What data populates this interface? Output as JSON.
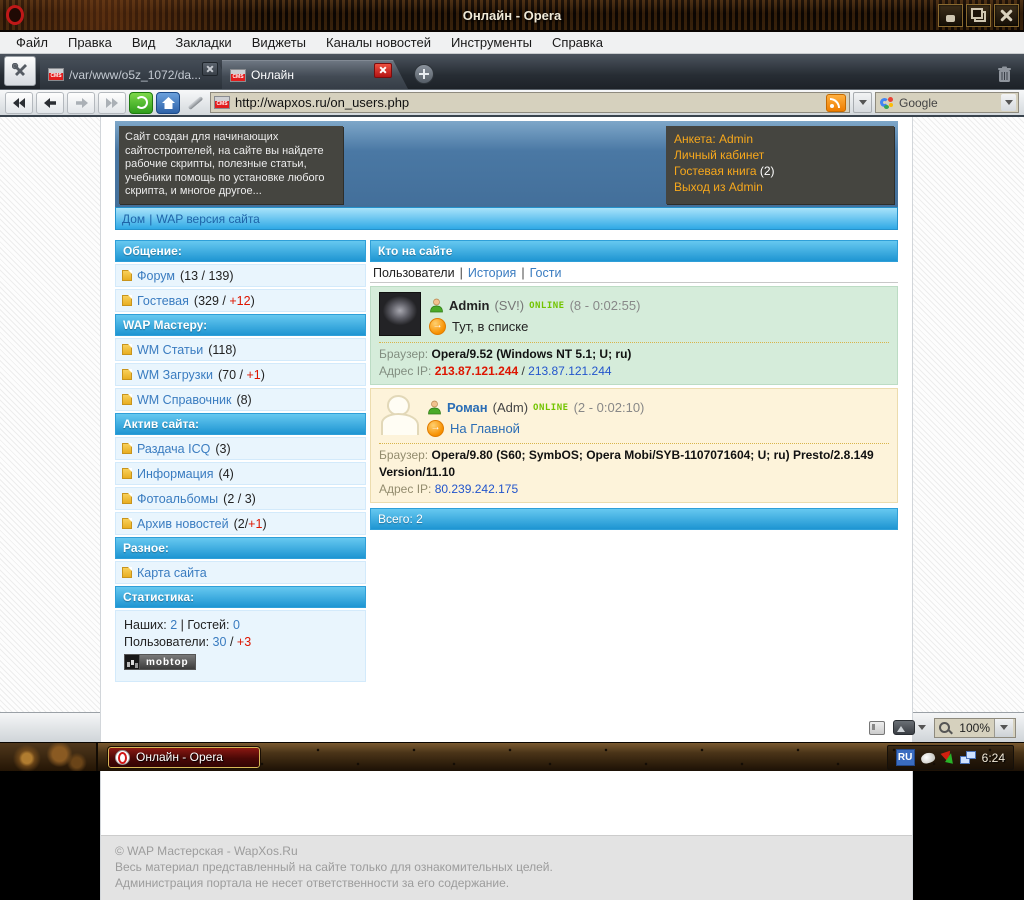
{
  "window": {
    "title": "Онлайн - Opera"
  },
  "menu": {
    "items": [
      "Файл",
      "Правка",
      "Вид",
      "Закладки",
      "Виджеты",
      "Каналы новостей",
      "Инструменты",
      "Справка"
    ]
  },
  "icons": {
    "cms": "CMS"
  },
  "tabs": {
    "tab1": "/var/www/o5z_1072/da...",
    "tab2": "Онлайн"
  },
  "address": {
    "url": "http://wapxos.ru/on_users.php",
    "search": "Google"
  },
  "site": {
    "description": "Сайт создан для начинающих сайтостроителей, на сайте вы найдете рабочие скрипты, полезные статьи, учебники помощь по установке любого скрипта, и многое другое...",
    "account": {
      "l1": "Анкета: Admin",
      "l2": "Личный кабинет",
      "l3": "Гостевая книга",
      "l3_count": "(2)",
      "l4": "Выход из Admin"
    },
    "breadcrumb": {
      "home": "Дом",
      "sep": "|",
      "wap": "WAP версия сайта"
    }
  },
  "sidebar": {
    "h1": "Общение:",
    "items1": [
      {
        "label": "Форум",
        "c1": "(13 / 139)",
        "red": "",
        "c2": ""
      },
      {
        "label": "Гостевая",
        "c1": "(329 / ",
        "red": "+12",
        "c2": ")"
      }
    ],
    "h2": "WAP Мастеру:",
    "items2": [
      {
        "label": "WM Статьи",
        "c1": "(118)",
        "red": "",
        "c2": ""
      },
      {
        "label": "WM Загрузки",
        "c1": "(70 / ",
        "red": "+1",
        "c2": ")"
      },
      {
        "label": "WM Справочник",
        "c1": "(8)",
        "red": "",
        "c2": ""
      }
    ],
    "h3": "Актив сайта:",
    "items3": [
      {
        "label": "Раздача ICQ",
        "c1": "(3)",
        "red": "",
        "c2": ""
      },
      {
        "label": "Информация",
        "c1": "(4)",
        "red": "",
        "c2": ""
      },
      {
        "label": "Фотоальбомы",
        "c1": "(2 / 3)",
        "red": "",
        "c2": ""
      },
      {
        "label": "Архив новостей",
        "c1": "(2/",
        "red": "+1",
        "c2": ")"
      }
    ],
    "h4": "Разное:",
    "items4": [
      {
        "label": "Карта сайта",
        "c1": "",
        "red": "",
        "c2": ""
      }
    ],
    "h5": "Статистика:",
    "stats": {
      "t1": "Наших:",
      "v1": "2",
      "t2": "| Гостей:",
      "v2": "0",
      "t3": "Пользователи:",
      "v3": "30",
      "t4": "/",
      "v4": "+3",
      "badge": "mobtop"
    }
  },
  "main": {
    "title": "Кто на сайте",
    "tabs": {
      "active": "Пользователи",
      "sep1": "|",
      "t2": "История",
      "sep2": "|",
      "t3": "Гости"
    },
    "users": [
      {
        "name": "Admin",
        "suffix": "(SV!)",
        "online": "ONLINE",
        "session": "(8 - 0:02:55)",
        "action": "Тут, в списке",
        "browser_label": "Браузер:",
        "browser": "Opera/9.52 (Windows NT 5.1; U; ru)",
        "ip_label": "Адрес IP:",
        "ip1": "213.87.121.244",
        "ip_sep": "/",
        "ip2": "213.87.121.244"
      },
      {
        "name": "Роман",
        "suffix": "(Adm)",
        "online": "ONLINE",
        "session": "(2 - 0:02:10)",
        "action": "На Главной",
        "browser_label": "Браузер:",
        "browser": "Opera/9.80 (S60; SymbOS; Opera Mobi/SYB-1107071604; U; ru) Presto/2.8.149 Version/11.10",
        "ip_label": "Адрес IP:",
        "ip1": "",
        "ip_sep": "",
        "ip2": "80.239.242.175"
      }
    ],
    "total": "Всего: 2"
  },
  "footer": {
    "lines": [
      "© WAP Мастерская - WapXos.Ru",
      "Весь материал представленный на сайте только для ознакомительных целей.",
      "Администрация портала не несет ответственности за его содержание."
    ]
  },
  "statusbar": {
    "zoom": "100%"
  },
  "taskbar": {
    "task": "Онлайн - Opera",
    "lang": "RU",
    "clock": "6:24"
  },
  "colors": {
    "header_blue": "#1e95d2",
    "link_blue": "#3a7cc0",
    "alert_red": "#dd1500",
    "online_green": "#72c400",
    "orange_link": "#f7a81c",
    "panel_dark": "#454540",
    "entry_green": "#d5ecda",
    "entry_cream": "#fdf3da",
    "addr_field": "#d6d1be"
  }
}
